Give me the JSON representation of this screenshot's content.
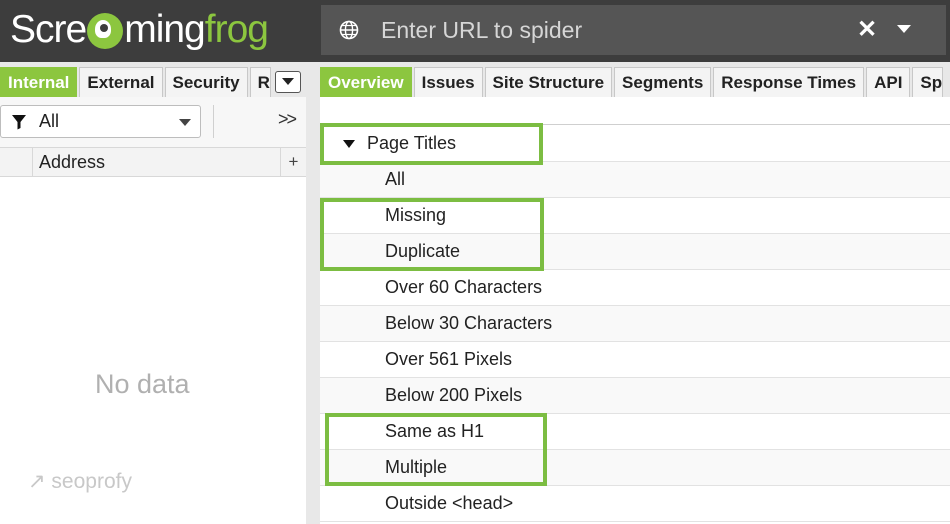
{
  "app": {
    "logo_parts": [
      "Scre",
      "ming",
      "frog"
    ],
    "colors": {
      "header_bg": "#3d3d3d",
      "accent": "#8cc63f",
      "highlight": "#7cbd42"
    }
  },
  "url_bar": {
    "placeholder": "Enter URL to spider",
    "globe_icon": "globe-icon",
    "clear_icon": "close-icon",
    "dropdown_icon": "chevron-down-icon"
  },
  "left_tabs": [
    {
      "label": "Internal",
      "active": true
    },
    {
      "label": "External",
      "active": false
    },
    {
      "label": "Security",
      "active": false
    },
    {
      "label": "R",
      "active": false
    }
  ],
  "right_tabs": [
    {
      "label": "Overview",
      "active": true
    },
    {
      "label": "Issues",
      "active": false
    },
    {
      "label": "Site Structure",
      "active": false
    },
    {
      "label": "Segments",
      "active": false
    },
    {
      "label": "Response Times",
      "active": false
    },
    {
      "label": "API",
      "active": false
    },
    {
      "label": "Sp",
      "active": false
    }
  ],
  "filter": {
    "value": "All",
    "expand": ">>"
  },
  "table": {
    "column": "Address",
    "add": "+"
  },
  "empty_state": "No data",
  "watermark": "↗ seoprofy",
  "tree": {
    "section": "Page Titles",
    "items": [
      "All",
      "Missing",
      "Duplicate",
      "Over 60 Characters",
      "Below 30 Characters",
      "Over 561 Pixels",
      "Below 200 Pixels",
      "Same as H1",
      "Multiple",
      "Outside <head>"
    ],
    "highlighted": [
      "Page Titles",
      "Missing",
      "Duplicate",
      "Same as H1",
      "Multiple"
    ]
  }
}
